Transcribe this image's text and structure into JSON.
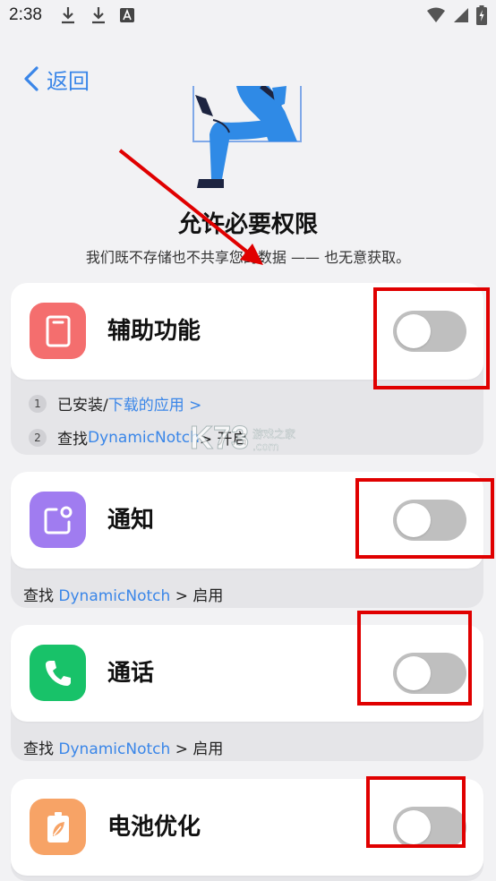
{
  "status_bar": {
    "time": "2:38"
  },
  "nav": {
    "back_label": "返回"
  },
  "header": {
    "title": "允许必要权限",
    "subtitle": "我们既不存储也不共享您的数据 —— 也无意获取。"
  },
  "permissions": [
    {
      "label": "辅助功能",
      "icon": "accessibility-icon",
      "icon_color": "#f46e6e",
      "enabled": false,
      "steps": [
        {
          "num": "1",
          "prefix": "已安装/",
          "link": "下载的应用 >",
          "suffix": ""
        },
        {
          "num": "2",
          "prefix": "查找 ",
          "link": "DynamicNotch",
          "suffix": " > 开启"
        }
      ]
    },
    {
      "label": "通知",
      "icon": "notification-icon",
      "icon_color": "#a07cf0",
      "enabled": false,
      "hint": {
        "prefix": "查找 ",
        "link": "DynamicNotch",
        "suffix": " > 启用"
      }
    },
    {
      "label": "通话",
      "icon": "phone-icon",
      "icon_color": "#18c269",
      "enabled": false,
      "hint": {
        "prefix": "查找 ",
        "link": "DynamicNotch",
        "suffix": " > 启用"
      }
    },
    {
      "label": "电池优化",
      "icon": "battery-icon",
      "icon_color": "#f7a366",
      "enabled": false
    }
  ],
  "watermark": {
    "brand": "K73",
    "text": "游戏之家",
    "domain": ".com"
  },
  "colors": {
    "accent": "#3a86e8",
    "annotation_red": "#e00000",
    "background": "#f2f2f4"
  }
}
